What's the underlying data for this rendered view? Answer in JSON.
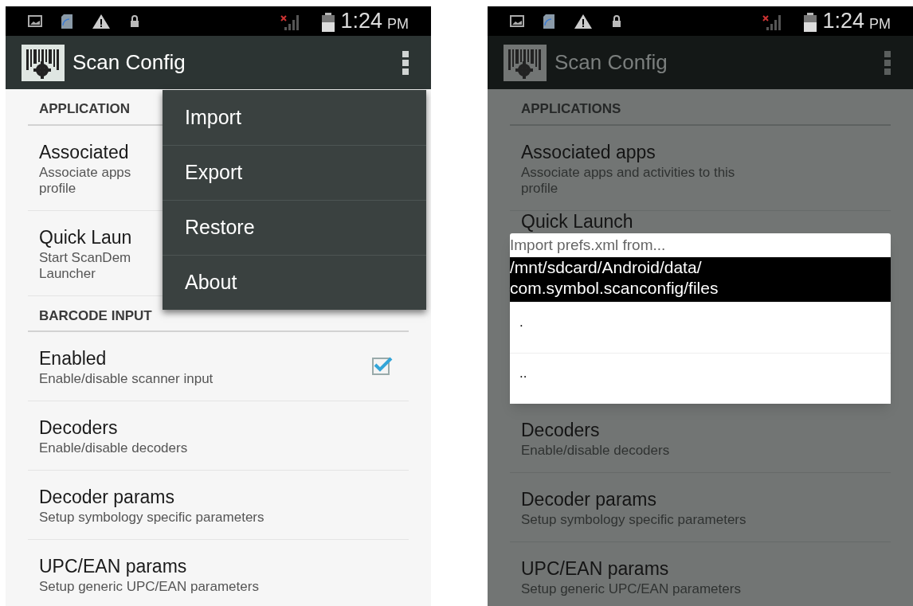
{
  "screens": [
    {
      "dimmed": false,
      "status_bar": {
        "time": "1:24",
        "ampm": "PM"
      },
      "app_bar": {
        "title": "Scan Config"
      },
      "list": [
        {
          "kind": "header",
          "label": "APPLICATION"
        },
        {
          "kind": "item",
          "title": "Associated",
          "summary": [
            "Associate apps",
            "profile"
          ]
        },
        {
          "kind": "item",
          "title": "Quick Laun",
          "summary": [
            "Start ScanDem",
            "Launcher"
          ]
        },
        {
          "kind": "header",
          "label": "BARCODE INPUT"
        },
        {
          "kind": "item",
          "title": "Enabled",
          "summary": [
            "Enable/disable scanner input"
          ],
          "checked": true
        },
        {
          "kind": "item",
          "title": "Decoders",
          "summary": [
            "Enable/disable decoders"
          ]
        },
        {
          "kind": "item",
          "title": "Decoder params",
          "summary": [
            "Setup symbology specific parameters"
          ]
        },
        {
          "kind": "item",
          "title": "UPC/EAN params",
          "summary": [
            "Setup generic UPC/EAN parameters"
          ]
        }
      ],
      "overflow_menu": [
        "Import",
        "Export",
        "Restore",
        "About"
      ]
    },
    {
      "dimmed": true,
      "status_bar": {
        "time": "1:24",
        "ampm": "PM"
      },
      "app_bar": {
        "title": "Scan Config"
      },
      "list": [
        {
          "kind": "header",
          "label": "APPLICATIONS"
        },
        {
          "kind": "item",
          "title": "Associated apps",
          "summary": [
            "Associate apps and activities to this",
            "profile"
          ]
        },
        {
          "kind": "peek",
          "title": "Quick Launch"
        },
        {
          "kind": "dialog",
          "title": "Import prefs.xml from...",
          "items": [
            {
              "label": "/mnt/sdcard/Android/data/ com.symbol.scanconfig/files",
              "selected": true
            },
            {
              "label": ".",
              "selected": false
            },
            {
              "label": "..",
              "selected": false
            }
          ]
        },
        {
          "kind": "item",
          "title": "Decoders",
          "summary": [
            "Enable/disable decoders"
          ]
        },
        {
          "kind": "item",
          "title": "Decoder params",
          "summary": [
            "Setup symbology specific parameters"
          ]
        },
        {
          "kind": "item",
          "title": "UPC/EAN params",
          "summary": [
            "Setup generic UPC/EAN parameters"
          ]
        }
      ]
    }
  ]
}
